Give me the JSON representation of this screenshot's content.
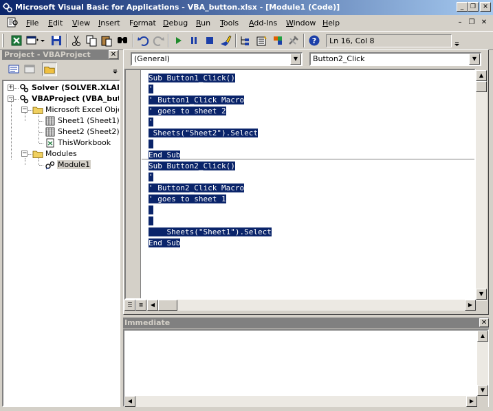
{
  "window": {
    "title": "Microsoft Visual Basic for Applications - VBA_button.xlsx - [Module1 (Code)]",
    "minimize_glyph": "_",
    "restore_glyph": "❐",
    "close_glyph": "✕"
  },
  "menubar": {
    "items": [
      {
        "accel": "F",
        "rest": "ile"
      },
      {
        "accel": "E",
        "rest": "dit"
      },
      {
        "accel": "V",
        "rest": "iew"
      },
      {
        "accel": "I",
        "rest": "nsert"
      },
      {
        "pre": "F",
        "accel": "o",
        "rest": "rmat"
      },
      {
        "accel": "D",
        "rest": "ebug"
      },
      {
        "accel": "R",
        "rest": "un"
      },
      {
        "accel": "T",
        "rest": "ools"
      },
      {
        "pre": "",
        "accel": "A",
        "rest": "dd-Ins"
      },
      {
        "accel": "W",
        "rest": "indow"
      },
      {
        "accel": "H",
        "rest": "elp"
      }
    ],
    "mdi_minimize": "–",
    "mdi_restore": "❐",
    "mdi_close": "✕"
  },
  "toolbar": {
    "status": "Ln 16, Col 8",
    "icons": [
      "view-excel-icon",
      "insert-userform-icon",
      "save-icon",
      "cut-icon",
      "copy-icon",
      "paste-icon",
      "find-icon",
      "undo-icon",
      "redo-icon",
      "run-icon",
      "break-icon",
      "reset-icon",
      "design-mode-icon",
      "project-explorer-icon",
      "properties-icon",
      "object-browser-icon",
      "toolbox-icon",
      "help-icon"
    ]
  },
  "project": {
    "title": "Project - VBAProject",
    "close_glyph": "✕",
    "tree": [
      {
        "label": "Solver (SOLVER.XLAM)",
        "bold": true,
        "level": 0,
        "expander": "+",
        "icon": "vba-project-icon"
      },
      {
        "label": "VBAProject (VBA_butt",
        "bold": true,
        "level": 0,
        "expander": "−",
        "icon": "vba-project-icon"
      },
      {
        "label": "Microsoft Excel Object",
        "level": 1,
        "expander": "−",
        "icon": "folder-icon"
      },
      {
        "label": "Sheet1 (Sheet1)",
        "level": 2,
        "icon": "sheet-icon"
      },
      {
        "label": "Sheet2 (Sheet2)",
        "level": 2,
        "icon": "sheet-icon"
      },
      {
        "label": "ThisWorkbook",
        "level": 2,
        "icon": "workbook-icon"
      },
      {
        "label": "Modules",
        "level": 1,
        "expander": "−",
        "icon": "folder-icon"
      },
      {
        "label": "Module1",
        "level": 2,
        "icon": "module-icon",
        "selected": true
      }
    ]
  },
  "code": {
    "object_combo": "(General)",
    "procedure_combo": "Button2_Click",
    "lines": [
      "Sub Button1_Click()",
      "'",
      "' Button1_Click Macro",
      "' goes to sheet 2",
      "'",
      " Sheets(\"Sheet2\").Select",
      " ",
      "End Sub",
      "Sub Button2_Click()",
      "'",
      "' Button2_Click Macro",
      "' goes to sheet 1",
      "",
      "",
      "    Sheets(\"Sheet1\").Select",
      "End Sub"
    ]
  },
  "immediate": {
    "title": "Immediate",
    "close_glyph": "✕"
  },
  "colors": {
    "titlebar_start": "#0a246a",
    "titlebar_end": "#a6caf0",
    "selection": "#0a246a",
    "panel_caption": "#808080",
    "face": "#d4d0c8"
  }
}
